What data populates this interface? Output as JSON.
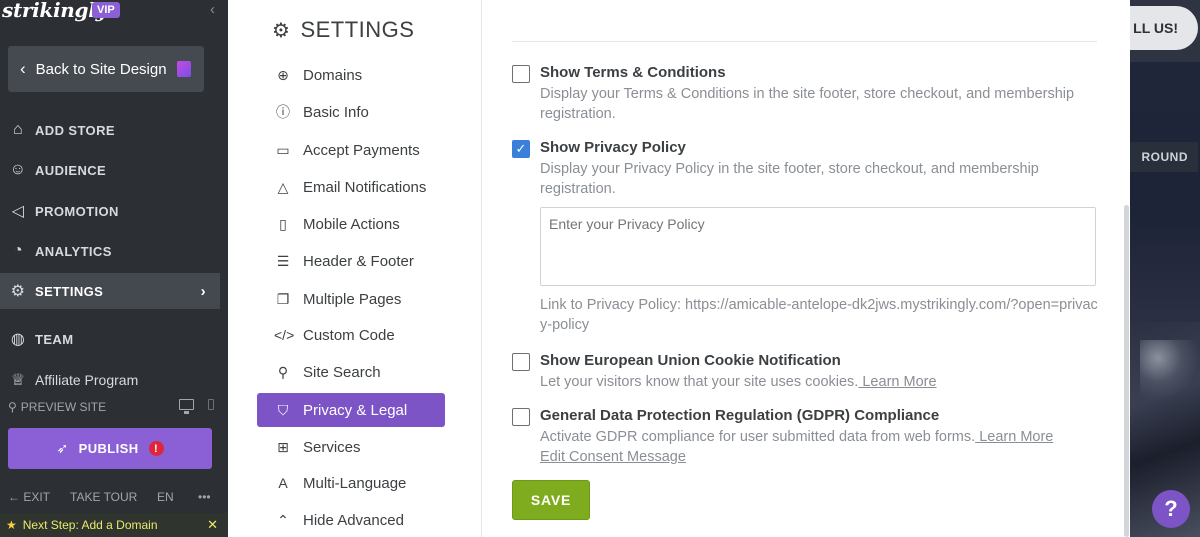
{
  "sidebar": {
    "logo": "strikingly",
    "vip_badge": "VIP",
    "back_label": "Back to Site Design",
    "nav": [
      {
        "label": "ADD STORE",
        "icon": "store-icon"
      },
      {
        "label": "AUDIENCE",
        "icon": "audience-icon"
      },
      {
        "label": "PROMOTION",
        "icon": "megaphone-icon"
      },
      {
        "label": "ANALYTICS",
        "icon": "pie-chart-icon"
      },
      {
        "label": "SETTINGS",
        "icon": "gear-icon"
      },
      {
        "label": "TEAM",
        "icon": "team-icon"
      },
      {
        "label": "Affiliate Program",
        "icon": "trophy-icon"
      }
    ],
    "preview_label": "PREVIEW SITE",
    "publish_label": "PUBLISH",
    "publish_alert": "!",
    "exit_label": "EXIT",
    "tour_label": "TAKE TOUR",
    "lang_label": "EN",
    "more_label": "•••",
    "next_step": "Next Step: Add a Domain"
  },
  "settings_nav": {
    "title": "SETTINGS",
    "items": [
      {
        "label": "Domains",
        "icon": "globe-icon"
      },
      {
        "label": "Basic Info",
        "icon": "info-icon"
      },
      {
        "label": "Accept Payments",
        "icon": "payment-icon"
      },
      {
        "label": "Email Notifications",
        "icon": "bell-icon"
      },
      {
        "label": "Mobile Actions",
        "icon": "mobile-icon"
      },
      {
        "label": "Header & Footer",
        "icon": "header-footer-icon"
      },
      {
        "label": "Multiple Pages",
        "icon": "pages-icon"
      },
      {
        "label": "Custom Code",
        "icon": "code-icon"
      },
      {
        "label": "Site Search",
        "icon": "search-icon"
      },
      {
        "label": "Privacy & Legal",
        "icon": "shield-icon"
      },
      {
        "label": "Services",
        "icon": "services-icon"
      },
      {
        "label": "Multi-Language",
        "icon": "language-icon"
      },
      {
        "label": "Hide Advanced",
        "icon": "chevron-up-icon"
      }
    ]
  },
  "content": {
    "terms": {
      "title": "Show Terms & Conditions",
      "desc": "Display your Terms & Conditions in the site footer, store checkout, and membership registration.",
      "checked": false
    },
    "privacy": {
      "title": "Show Privacy Policy",
      "desc": "Display your Privacy Policy in the site footer, store checkout, and membership registration.",
      "checked": true,
      "placeholder": "Enter your Privacy Policy",
      "link_text": "Link to Privacy Policy: https://amicable-antelope-dk2jws.mystrikingly.com/?open=privacy-policy"
    },
    "cookie": {
      "title": "Show European Union Cookie Notification",
      "desc": "Let your visitors know that your site uses cookies.",
      "learn_more": " Learn More",
      "checked": false
    },
    "gdpr": {
      "title": "General Data Protection Regulation (GDPR) Compliance",
      "desc": "Activate GDPR compliance for user submitted data from web forms.",
      "learn_more": " Learn More",
      "consent_link": "Edit Consent Message",
      "checked": false
    },
    "save_label": "SAVE"
  },
  "preview": {
    "call_us": "LL US!",
    "ground": "ROUND",
    "help": "?"
  }
}
